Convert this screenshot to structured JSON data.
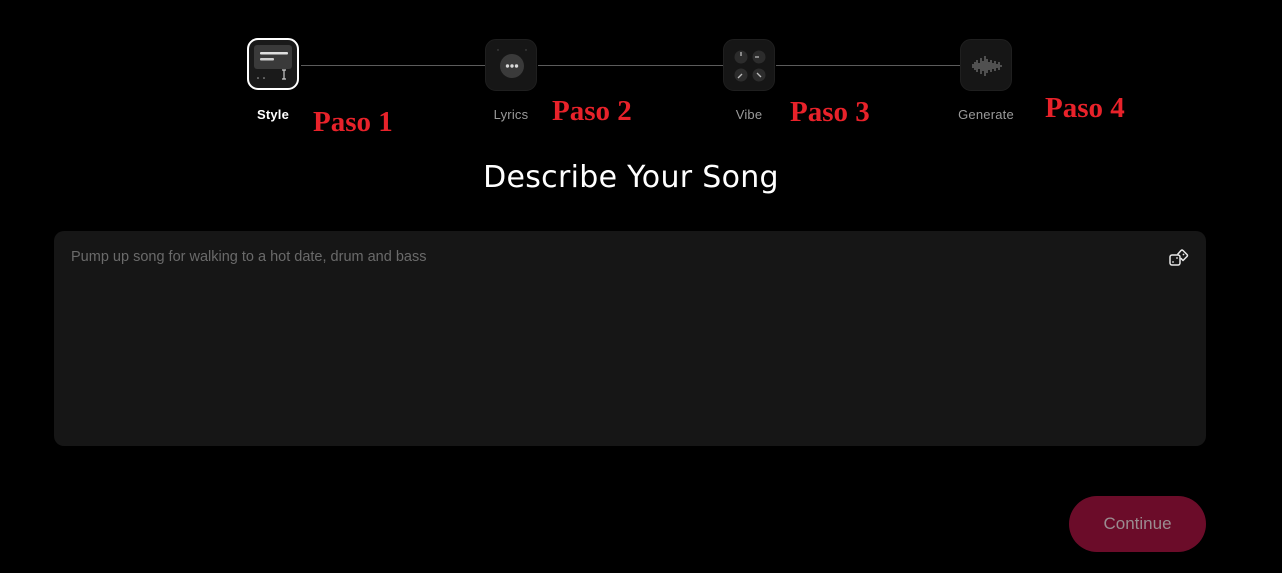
{
  "stepper": {
    "steps": [
      {
        "label": "Style",
        "annotation": "Paso 1",
        "active": true,
        "icon": "style-editor-icon"
      },
      {
        "label": "Lyrics",
        "annotation": "Paso 2",
        "active": false,
        "icon": "chat-bubble-icon"
      },
      {
        "label": "Vibe",
        "annotation": "Paso 3",
        "active": false,
        "icon": "knobs-icon"
      },
      {
        "label": "Generate",
        "annotation": "Paso 4",
        "active": false,
        "icon": "waveform-icon"
      }
    ]
  },
  "main": {
    "title": "Describe Your Song",
    "prompt": {
      "value": "",
      "placeholder": "Pump up song for walking to a hot date, drum and bass",
      "random_icon": "dice-icon"
    },
    "continue_label": "Continue"
  },
  "colors": {
    "background": "#000000",
    "panel": "#161616",
    "annotation_red": "#e8222a",
    "continue_button": "#6b0c29"
  }
}
